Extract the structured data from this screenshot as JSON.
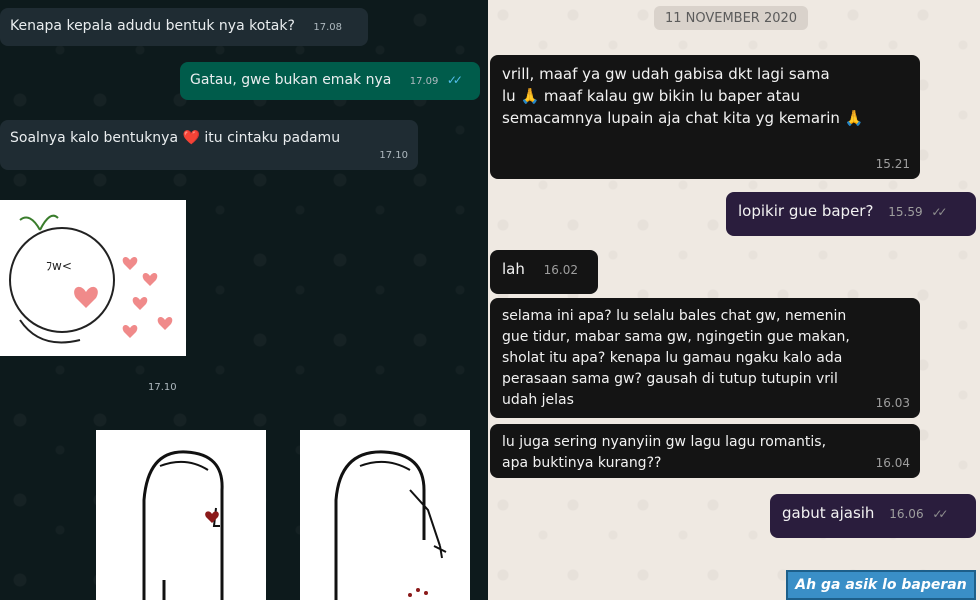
{
  "left_chat": {
    "messages": [
      {
        "text": "Kenapa kepala adudu bentuk nya kotak?",
        "time": "17.08"
      },
      {
        "text": "Gatau, gwe bukan emak nya",
        "time": "17.09",
        "ticks": "✓✓"
      },
      {
        "text_before": "Soalnya kalo bentuknya",
        "emoji": "❤️",
        "text_after": "itu cintaku padamu",
        "time": "17.10"
      }
    ],
    "sticker_time": "17.10"
  },
  "right_chat": {
    "date_chip": "11 NOVEMBER 2020",
    "messages": [
      {
        "lines": [
          "vrill, maaf ya gw udah gabisa dkt lagi sama",
          "lu 🙏 maaf kalau gw bikin lu baper atau",
          "semacamnya lupain aja chat kita yg kemarin 🙏"
        ],
        "time": "15.21"
      },
      {
        "text": "lopikir gue baper?",
        "time": "15.59",
        "ticks": "✓✓"
      },
      {
        "text": "lah",
        "time": "16.02"
      },
      {
        "lines": [
          "selama ini apa? lu selalu bales chat gw, nemenin",
          "gue tidur, mabar sama gw, ngingetin gue makan,",
          "sholat itu apa? kenapa lu gamau ngaku kalo ada",
          "perasaan sama gw? gausah di tutup tutupin vril",
          "udah jelas"
        ],
        "time": "16.03"
      },
      {
        "lines": [
          "lu juga sering nyanyiin gw lagu lagu romantis,",
          "apa buktinya kurang??"
        ],
        "time": "16.04"
      },
      {
        "text": "gabut ajasih",
        "time": "16.06",
        "ticks": "✓✓"
      }
    ],
    "caption": "Ah ga asik lo baperan"
  },
  "colors": {
    "left_bg": "#0d1a1c",
    "incoming_dark": "#1f2c33",
    "outgoing_green": "#005c4b",
    "read_ticks": "#53bdeb",
    "right_bg": "#efe9e2",
    "right_incoming": "#141414",
    "right_outgoing": "#2a1d3d"
  }
}
